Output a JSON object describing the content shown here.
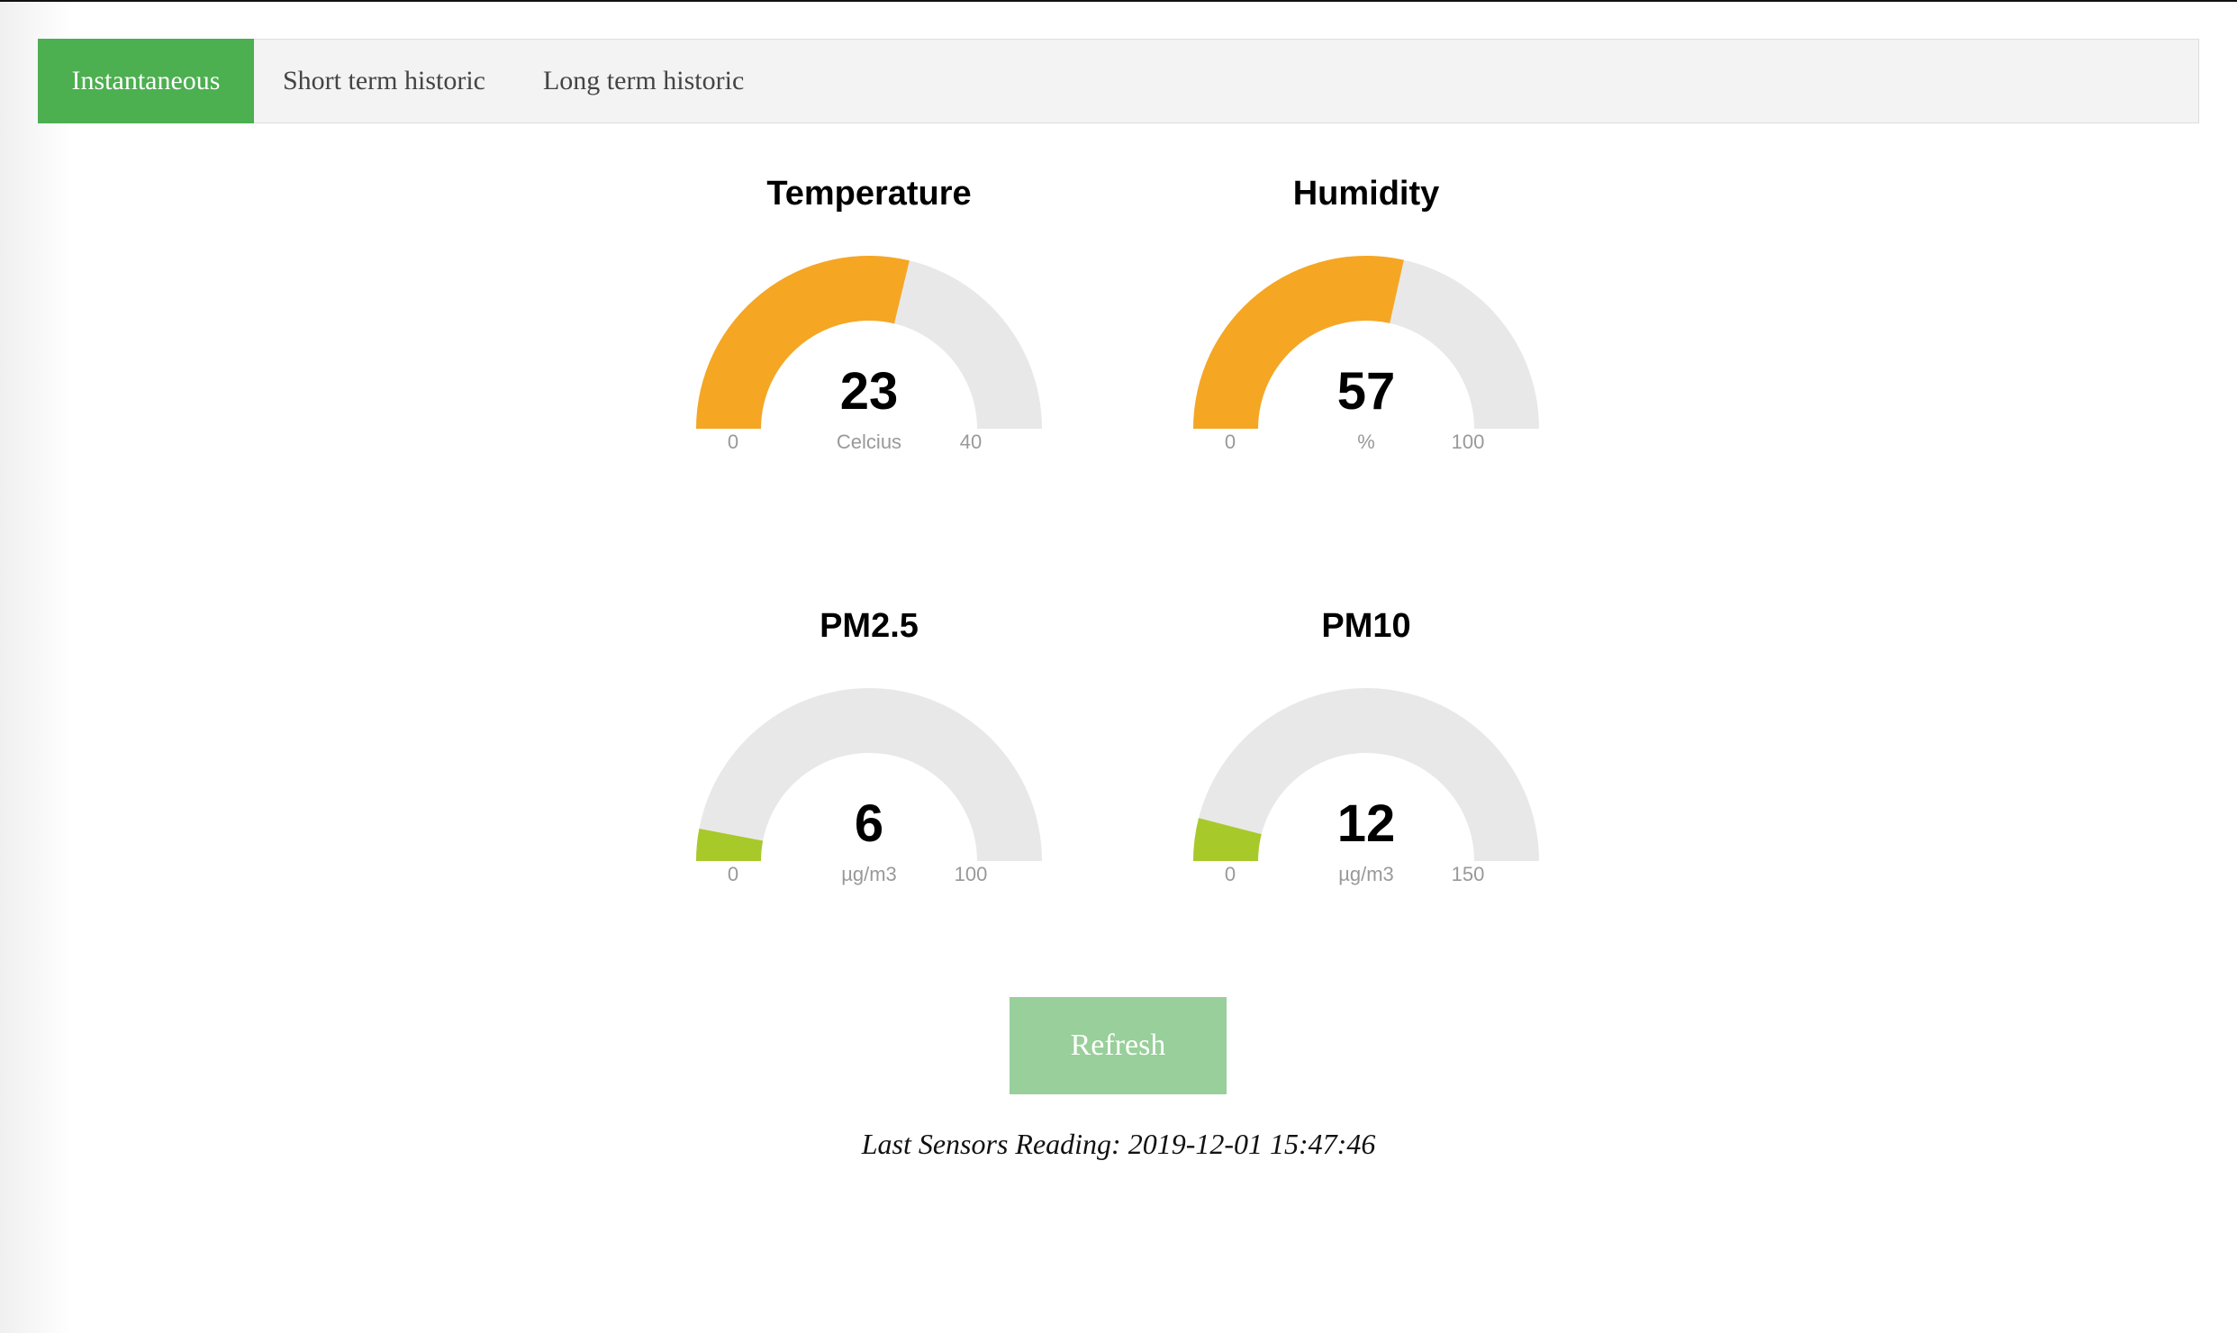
{
  "tabs": [
    {
      "label": "Instantaneous",
      "active": true
    },
    {
      "label": "Short term historic",
      "active": false
    },
    {
      "label": "Long term historic",
      "active": false
    }
  ],
  "gauges": [
    {
      "title": "Temperature",
      "value": "23",
      "unit": "Celcius",
      "min": "0",
      "max": "40",
      "fraction": 0.575,
      "color": "#f5a623"
    },
    {
      "title": "Humidity",
      "value": "57",
      "unit": "%",
      "min": "0",
      "max": "100",
      "fraction": 0.57,
      "color": "#f5a623"
    },
    {
      "title": "PM2.5",
      "value": "6",
      "unit": "µg/m3",
      "min": "0",
      "max": "100",
      "fraction": 0.06,
      "color": "#a8c92a"
    },
    {
      "title": "PM10",
      "value": "12",
      "unit": "µg/m3",
      "min": "0",
      "max": "150",
      "fraction": 0.08,
      "color": "#a8c92a"
    }
  ],
  "track_color": "#e9e8e8",
  "refresh_label": "Refresh",
  "last_reading": {
    "label": "Last Sensors Reading:",
    "timestamp": "2019-12-01 15:47:46"
  }
}
